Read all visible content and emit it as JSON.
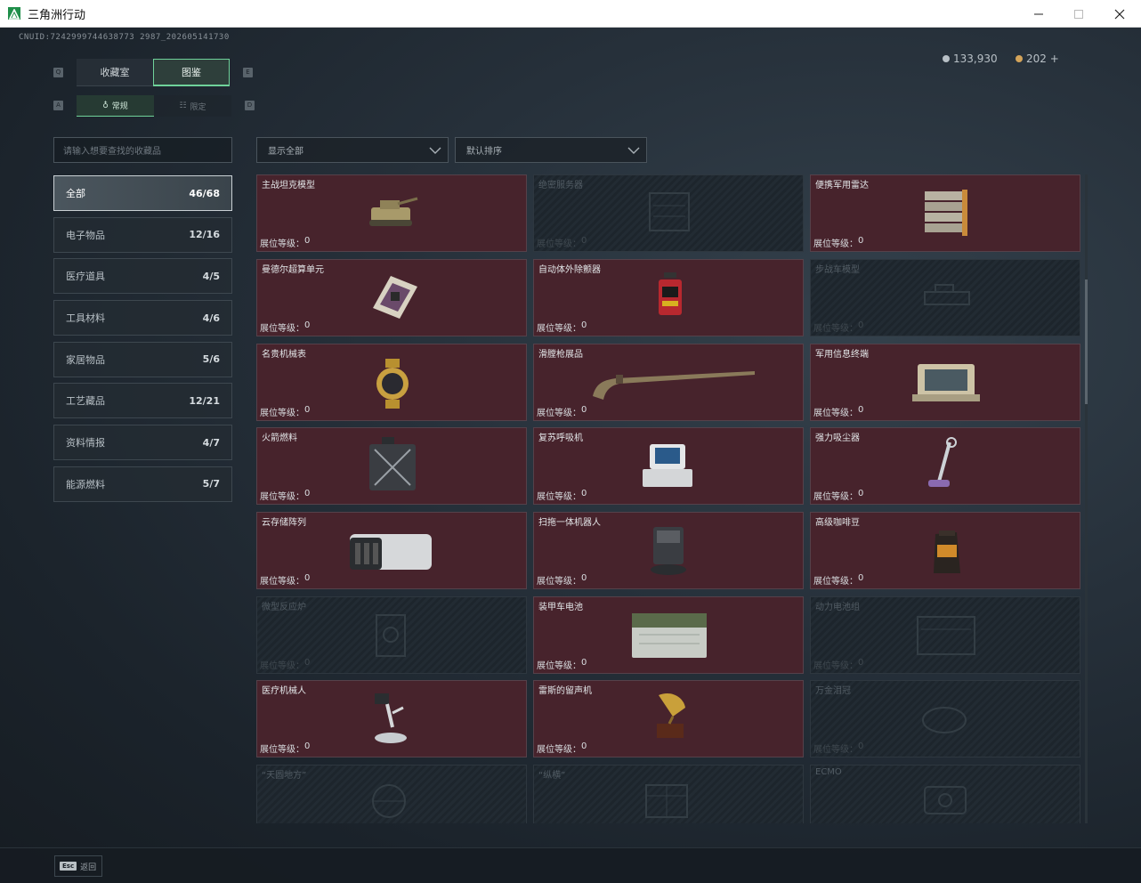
{
  "window": {
    "title": "三角洲行动",
    "minimize": "—",
    "maximize": "☐",
    "close": "✕"
  },
  "uid": "CNUID:7242999744638773 2987_202605141730",
  "currency": [
    {
      "value": "133,930",
      "color": "#b8c0c6"
    },
    {
      "value": "202 +",
      "color": "#d4a45a"
    }
  ],
  "keys": {
    "tab_prev": "Q",
    "tab_next": "E",
    "sub_prev": "A",
    "sub_next": "D"
  },
  "tabs": [
    {
      "label": "收藏室",
      "active": false
    },
    {
      "label": "图鉴",
      "active": true
    }
  ],
  "subtabs": [
    {
      "label": "常规",
      "active": true
    },
    {
      "label": "限定",
      "active": false
    }
  ],
  "search": {
    "placeholder": "请输入想要查找的收藏品"
  },
  "categories": [
    {
      "name": "全部",
      "count": "46/68",
      "active": true
    },
    {
      "name": "电子物品",
      "count": "12/16"
    },
    {
      "name": "医疗道具",
      "count": "4/5"
    },
    {
      "name": "工具材料",
      "count": "4/6"
    },
    {
      "name": "家居物品",
      "count": "5/6"
    },
    {
      "name": "工艺藏品",
      "count": "12/21"
    },
    {
      "name": "资料情报",
      "count": "4/7"
    },
    {
      "name": "能源燃料",
      "count": "5/7"
    }
  ],
  "filters": {
    "display": "显示全部",
    "sort": "默认排序"
  },
  "level_label": "展位等级：",
  "items": [
    {
      "name": "主战坦克模型",
      "level": "0",
      "unlocked": true,
      "icon": "tank-model-icon"
    },
    {
      "name": "绝密服务器",
      "level": "0",
      "unlocked": false,
      "icon": "server-icon"
    },
    {
      "name": "便携军用雷达",
      "level": "0",
      "unlocked": true,
      "icon": "radar-icon"
    },
    {
      "name": "曼德尔超算单元",
      "level": "0",
      "unlocked": true,
      "icon": "supercomputer-unit-icon"
    },
    {
      "name": "自动体外除颤器",
      "level": "0",
      "unlocked": true,
      "icon": "defibrillator-icon"
    },
    {
      "name": "步战车模型",
      "level": "0",
      "unlocked": false,
      "icon": "ifv-model-icon"
    },
    {
      "name": "名贵机械表",
      "level": "0",
      "unlocked": true,
      "icon": "watch-icon"
    },
    {
      "name": "滑膛枪展品",
      "level": "0",
      "unlocked": true,
      "icon": "musket-icon"
    },
    {
      "name": "军用信息终端",
      "level": "0",
      "unlocked": true,
      "icon": "terminal-icon"
    },
    {
      "name": "火箭燃料",
      "level": "0",
      "unlocked": true,
      "icon": "fuel-canister-icon"
    },
    {
      "name": "复苏呼吸机",
      "level": "0",
      "unlocked": true,
      "icon": "ventilator-icon"
    },
    {
      "name": "强力吸尘器",
      "level": "0",
      "unlocked": true,
      "icon": "vacuum-icon"
    },
    {
      "name": "云存储阵列",
      "level": "0",
      "unlocked": true,
      "icon": "storage-array-icon"
    },
    {
      "name": "扫拖一体机器人",
      "level": "0",
      "unlocked": true,
      "icon": "mop-robot-icon"
    },
    {
      "name": "高级咖啡豆",
      "level": "0",
      "unlocked": true,
      "icon": "coffee-bag-icon"
    },
    {
      "name": "微型反应炉",
      "level": "0",
      "unlocked": false,
      "icon": "reactor-icon"
    },
    {
      "name": "装甲车电池",
      "level": "0",
      "unlocked": true,
      "icon": "battery-icon"
    },
    {
      "name": "动力电池组",
      "level": "0",
      "unlocked": false,
      "icon": "battery-pack-icon"
    },
    {
      "name": "医疗机械人",
      "level": "0",
      "unlocked": true,
      "icon": "medical-robot-icon"
    },
    {
      "name": "雷斯的留声机",
      "level": "0",
      "unlocked": true,
      "icon": "gramophone-icon"
    },
    {
      "name": "万金泪冠",
      "level": "0",
      "unlocked": false,
      "icon": "crown-icon"
    },
    {
      "name": "“天圆地方”",
      "level": "",
      "unlocked": false,
      "icon": "globe-icon"
    },
    {
      "name": "“纵横”",
      "level": "",
      "unlocked": false,
      "icon": "board-icon"
    },
    {
      "name": "ECMO",
      "level": "",
      "unlocked": false,
      "icon": "ecmo-icon"
    }
  ],
  "bottom": {
    "esc_key": "Esc",
    "esc_label": "返回"
  }
}
